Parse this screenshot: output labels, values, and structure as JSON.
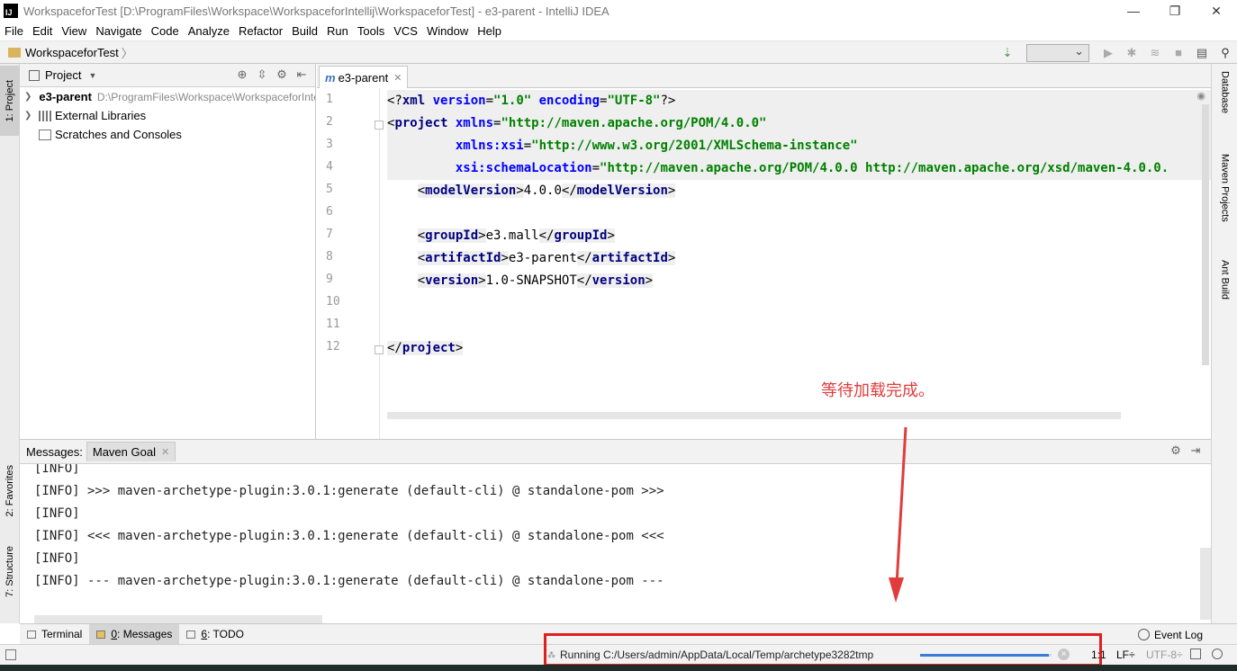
{
  "window": {
    "title": "WorkspaceforTest [D:\\ProgramFiles\\Workspace\\WorkspaceforIntellij\\WorkspaceforTest] - e3-parent - IntelliJ IDEA",
    "logo": "IJ",
    "controls": [
      "—",
      "❐",
      "✕"
    ]
  },
  "menu": [
    "File",
    "Edit",
    "View",
    "Navigate",
    "Code",
    "Analyze",
    "Refactor",
    "Build",
    "Run",
    "Tools",
    "VCS",
    "Window",
    "Help"
  ],
  "breadcrumb": {
    "project": "WorkspaceforTest",
    "separator": "〉"
  },
  "left_strip": {
    "project_tab": "1: Project",
    "favorites_tab": "2: Favorites",
    "structure_tab": "7: Structure"
  },
  "right_strip": {
    "database": "Database",
    "maven": "Maven Projects",
    "ant": "Ant Build"
  },
  "project_panel": {
    "title": "Project",
    "tree": [
      {
        "name": "e3-parent",
        "path": "D:\\ProgramFiles\\Workspace\\WorkspaceforIntellij"
      },
      {
        "name": "External Libraries"
      },
      {
        "name": "Scratches and Consoles"
      }
    ]
  },
  "editor": {
    "tab": "e3-parent",
    "tab_icon": "m",
    "line_numbers": [
      "1",
      "2",
      "3",
      "4",
      "5",
      "6",
      "7",
      "8",
      "9",
      "10",
      "11",
      "12"
    ],
    "lines": {
      "l1a": "<?",
      "l1b": "xml ",
      "l1c": "version",
      "l1d": "=",
      "l1e": "\"1.0\"",
      "l1f": " encoding",
      "l1g": "=",
      "l1h": "\"UTF-8\"",
      "l1i": "?>",
      "l2a": "<",
      "l2b": "project ",
      "l2c": "xmlns",
      "l2d": "=",
      "l2e": "\"http://maven.apache.org/POM/4.0.0\"",
      "l3a": "xmlns:xsi",
      "l3b": "=",
      "l3c": "\"http://www.w3.org/2001/XMLSchema-instance\"",
      "l4a": "xsi:schemaLocation",
      "l4b": "=",
      "l4c": "\"http://maven.apache.org/POM/4.0.0 http://maven.apache.org/xsd/maven-4.0.0.",
      "l5open": "<",
      "l5tag": "modelVersion",
      "l5close": ">",
      "l5val": "4.0.0",
      "l5end": "</",
      "l5endtag": "modelVersion",
      "l5endclose": ">",
      "l7open": "<",
      "l7tag": "groupId",
      "l7close": ">",
      "l7val": "e3.mall",
      "l7end": "</",
      "l7endtag": "groupId",
      "l7endclose": ">",
      "l8open": "<",
      "l8tag": "artifactId",
      "l8close": ">",
      "l8val": "e3-parent",
      "l8end": "</",
      "l8endtag": "artifactId",
      "l8endclose": ">",
      "l9open": "<",
      "l9tag": "version",
      "l9close": ">",
      "l9val": "1.0-SNAPSHOT",
      "l9end": "</",
      "l9endtag": "version",
      "l9endclose": ">",
      "l12open": "</",
      "l12tag": "project",
      "l12close": ">"
    }
  },
  "annotation": "等待加载完成。",
  "messages": {
    "label": "Messages:",
    "tab": "Maven Goal",
    "lines": [
      "[INFO]",
      "[INFO] >>> maven-archetype-plugin:3.0.1:generate (default-cli) @ standalone-pom >>>",
      "[INFO]",
      "[INFO] <<< maven-archetype-plugin:3.0.1:generate (default-cli) @ standalone-pom <<<",
      "[INFO]",
      "[INFO] --- maven-archetype-plugin:3.0.1:generate (default-cli) @ standalone-pom ---"
    ]
  },
  "bottom_tabs": {
    "terminal": "Terminal",
    "messages_num": "0",
    "messages": ": Messages",
    "todo_num": "6",
    "todo": ": TODO",
    "event_log": "Event Log"
  },
  "status": {
    "running": "Running C:/Users/admin/AppData/Local/Temp/archetype3282tmp",
    "progress": 0.98,
    "position": "1:1",
    "line_sep": "LF÷",
    "encoding": "UTF-8÷"
  },
  "colors": {
    "annotation": "#e03c3c",
    "highlight_box": "#e02020",
    "progress": "#3a7bd5"
  }
}
